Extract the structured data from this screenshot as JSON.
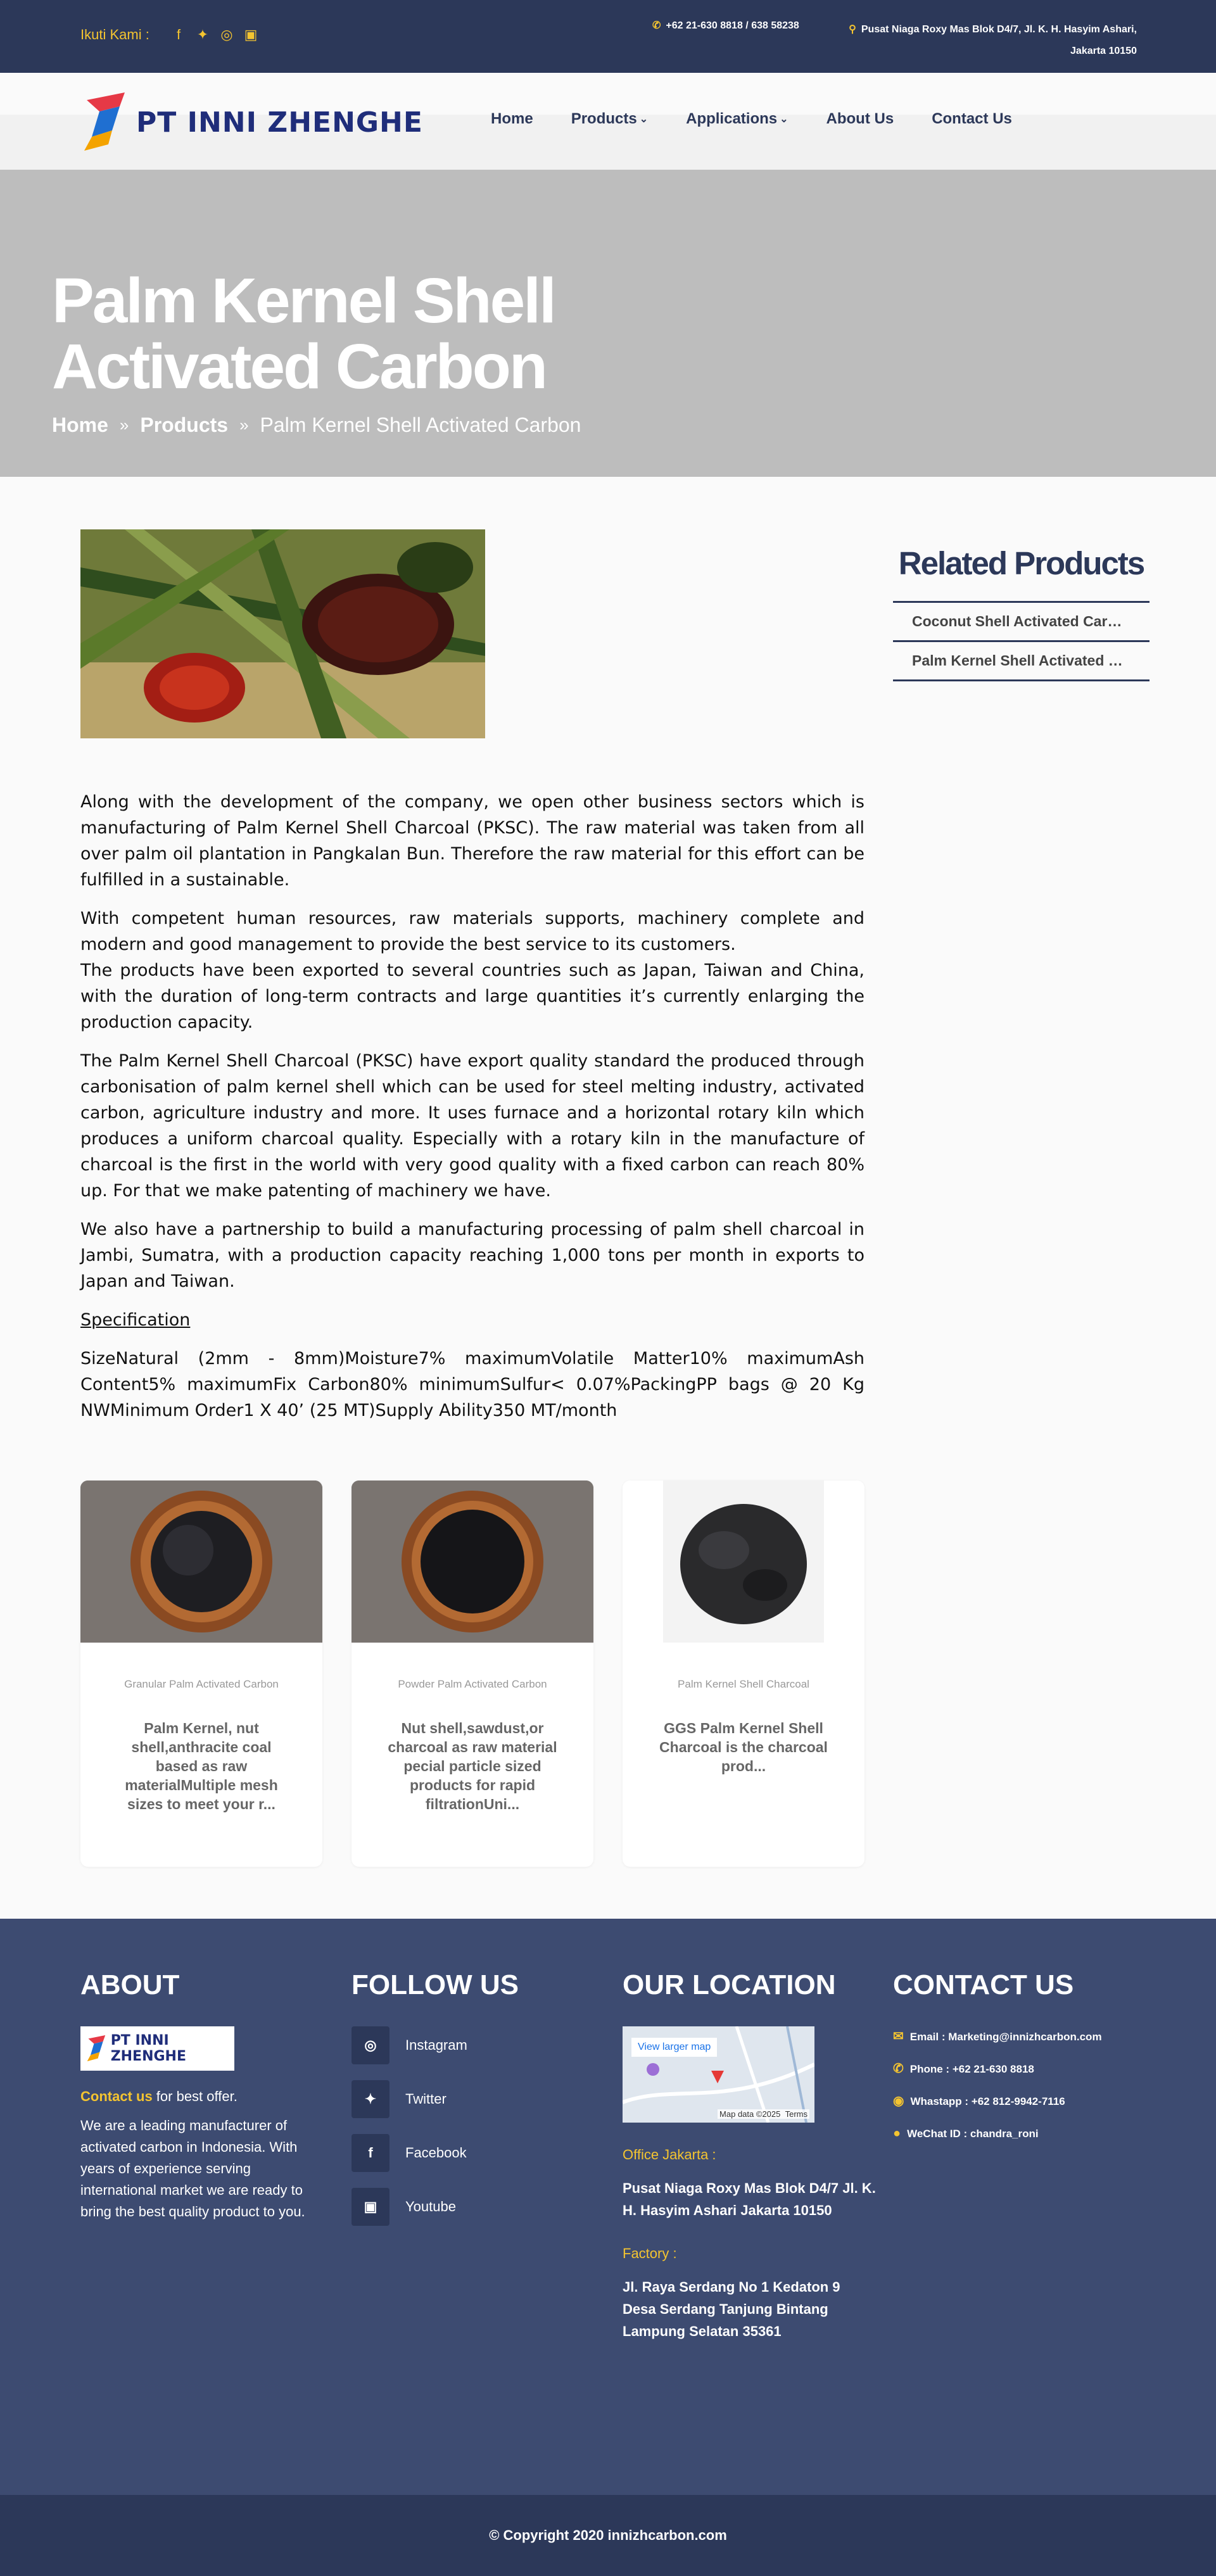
{
  "topbar": {
    "follow_label": "Ikuti Kami :",
    "social_icons": [
      "facebook-icon",
      "twitter-icon",
      "instagram-icon",
      "youtube-icon"
    ],
    "phone": "+62 21-630 8818 / 638 58238",
    "address": "Pusat Niaga Roxy Mas Blok D4/7, Jl. K. H. Hasyim Ashari, Jakarta 10150"
  },
  "logo": {
    "name": "PT INNI ZHENGHE"
  },
  "nav": {
    "items": [
      {
        "label": "Home"
      },
      {
        "label": "Products"
      },
      {
        "label": "Applications"
      },
      {
        "label": "About Us"
      },
      {
        "label": "Contact Us"
      }
    ]
  },
  "hero": {
    "title": "Palm Kernel Shell Activated Carbon",
    "breadcrumb": [
      "Home",
      "Products",
      "Palm Kernel Shell Activated Carbon"
    ]
  },
  "article": {
    "paragraphs": [
      "Along with the development of the company, we open other business sectors which is manufacturing of Palm Kernel Shell Charcoal (PKSC). The raw material was taken from all over palm oil plantation in Pangkalan Bun. Therefore the raw material for this effort can be fulfilled in a sustainable.",
      "With competent human resources, raw materials supports, machinery complete and modern and good management to provide the best service to its customers.",
      "The products have been exported to several countries such as Japan, Taiwan and China, with the duration of long-term contracts and large quantities it’s currently enlarging the production capacity.",
      "The Palm Kernel Shell Charcoal (PKSC) have export quality standard the produced through carbonisation of palm kernel shell which can be used for steel melting industry, activated carbon, agriculture industry and more. It uses furnace and a horizontal rotary kiln which produces a uniform charcoal quality. Especially with a rotary kiln in the manufacture of charcoal is the first in the world with very good quality with a fixed carbon can reach 80% up. For that we make patenting of machinery we have.",
      "We also have a partnership to build a manufacturing processing of palm shell charcoal in Jambi, Sumatra, with a production capacity reaching 1,000 tons per month in exports to Japan and Taiwan."
    ],
    "spec_title": "Specification",
    "spec_text": "SizeNatural (2mm - 8mm)Moisture7% maximumVolatile Matter10% maximumAsh Content5% maximumFix Carbon80% minimumSulfur< 0.07%PackingPP bags @ 20 Kg NWMinimum Order1 X 40’ (25 MT)Supply Ability350 MT/month"
  },
  "related": {
    "title": "Related Products",
    "items": [
      "Coconut Shell Activated Carbon",
      "Palm Kernel Shell Activated Carbon"
    ]
  },
  "cards": [
    {
      "caption": "Granular Palm Activated Carbon",
      "desc": "Palm  Kernel, nut shell,anthracite coal based as raw materialMultiple mesh sizes to meet your r..."
    },
    {
      "caption": "Powder Palm Activated Carbon",
      "desc": "Nut shell,sawdust,or charcoal as raw material pecial particle sized products for rapid filtrationUni..."
    },
    {
      "caption": "Palm Kernel Shell Charcoal",
      "desc": "GGS Palm Kernel Shell Charcoal is the charcoal prod..."
    }
  ],
  "footer": {
    "about": {
      "title": "ABOUT",
      "cta_highlight": "Contact us",
      "cta_rest": " for best offer.",
      "text": "We are a leading manufacturer of activated carbon in Indonesia. With years of experience serving international market we are ready to bring the best quality product to you."
    },
    "follow": {
      "title": "FOLLOW US",
      "items": [
        "Instagram",
        "Twitter",
        "Facebook",
        "Youtube"
      ]
    },
    "location": {
      "title": "OUR LOCATION",
      "map_link": "View larger map",
      "map_data": "Map data ©2025",
      "map_terms": "Terms",
      "office_label": "Office Jakarta :",
      "office_address": "Pusat Niaga Roxy Mas Blok D4/7 Jl. K. H. Hasyim Ashari Jakarta 10150",
      "factory_label": "Factory :",
      "factory_address": "Jl. Raya Serdang No 1 Kedaton 9 Desa Serdang Tanjung Bintang Lampung Selatan 35361"
    },
    "contact": {
      "title": "CONTACT US",
      "email": "Email : Marketing@innizhcarbon.com",
      "phone": "Phone : +62 21-630 8818",
      "whatsapp": "Whastapp : +62 812-9942-7116",
      "wechat": "WeChat ID : chandra_roni"
    }
  },
  "copyright": "© Copyright 2020 innizhcarbon.com",
  "colors": {
    "navy": "#2c3859",
    "footer": "#3d4b71",
    "accent": "#f4c430"
  }
}
